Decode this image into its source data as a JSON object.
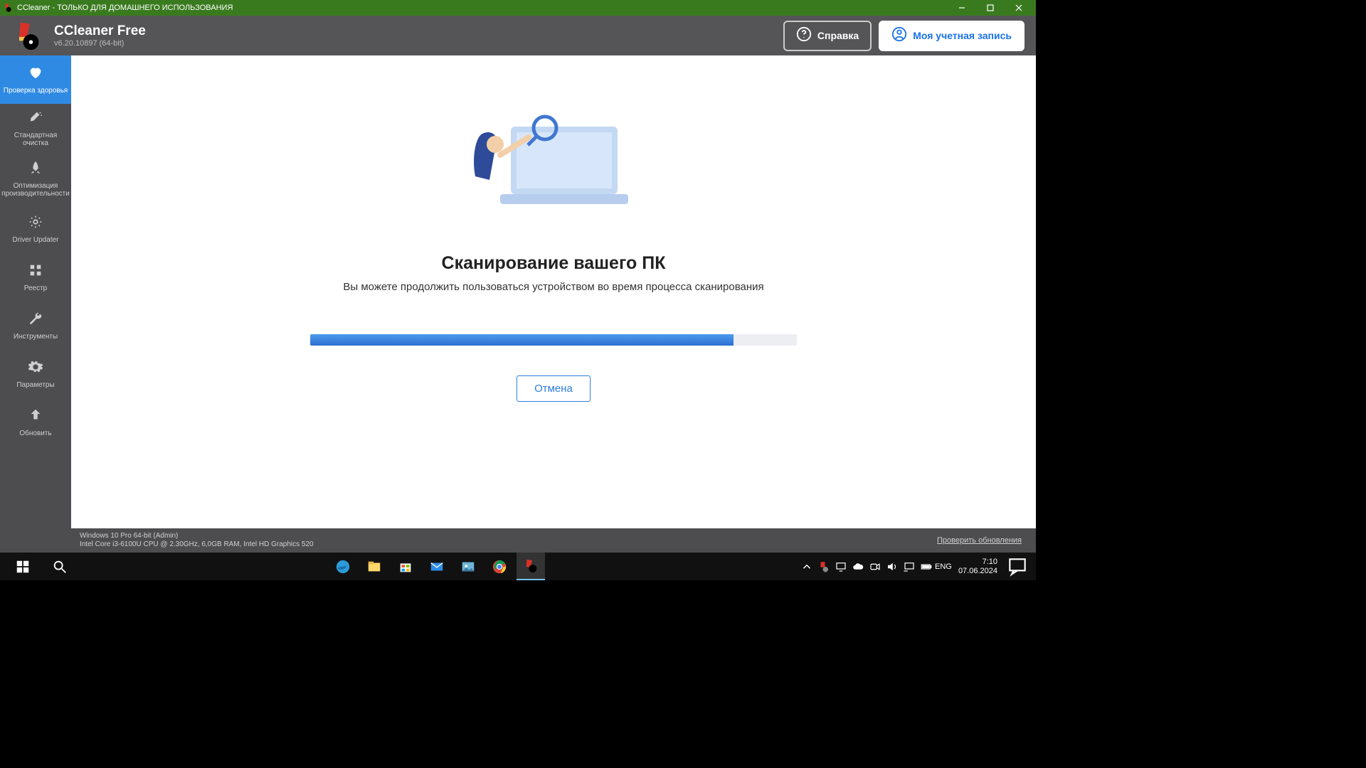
{
  "titlebar": {
    "title": "CCleaner - ТОЛЬКО ДЛЯ ДОМАШНЕГО ИСПОЛЬЗОВАНИЯ"
  },
  "header": {
    "app_name": "CCleaner Free",
    "app_version": "v6.20.10897 (64-bit)",
    "help_label": "Справка",
    "account_label": "Моя учетная запись"
  },
  "sidebar": {
    "items": [
      {
        "label": "Проверка здоровья"
      },
      {
        "label": "Стандартная очистка"
      },
      {
        "label": "Оптимизация производительности"
      },
      {
        "label": "Driver Updater"
      },
      {
        "label": "Реестр"
      },
      {
        "label": "Инструменты"
      },
      {
        "label": "Параметры"
      },
      {
        "label": "Обновить"
      }
    ]
  },
  "main": {
    "title": "Сканирование вашего ПК",
    "subtitle": "Вы можете продолжить пользоваться устройством во время процесса сканирования",
    "cancel_label": "Отмена",
    "progress_percent": 87
  },
  "statusbar": {
    "os_line": "Windows 10 Pro 64-bit (Admin)",
    "hw_line": "Intel Core i3-6100U CPU @ 2.30GHz, 6,0GB RAM, Intel HD Graphics 520",
    "check_updates": "Проверить обновления"
  },
  "taskbar": {
    "lang": "ENG",
    "time": "7:10",
    "date": "07.06.2024"
  }
}
